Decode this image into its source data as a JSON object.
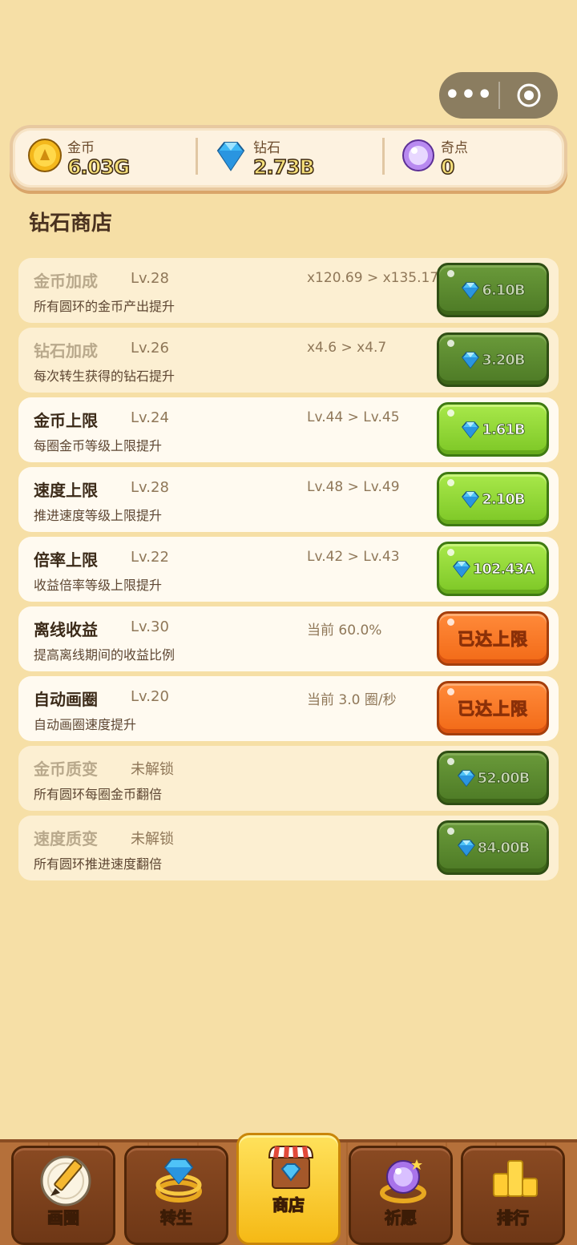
{
  "capsule": {
    "more_label": "•••"
  },
  "currency": {
    "gold": {
      "label": "金币",
      "value": "6.03G"
    },
    "diamond": {
      "label": "钻石",
      "value": "2.73B"
    },
    "wonder": {
      "label": "奇点",
      "value": "0"
    }
  },
  "shop": {
    "title": "钻石商店",
    "items": [
      {
        "name": "金币加成",
        "level": "Lv.28",
        "upgrade": "x120.69 > x135.17",
        "desc": "所有圆环的金币产出提升",
        "button": "6.10B",
        "state": "dim-dark"
      },
      {
        "name": "钻石加成",
        "level": "Lv.26",
        "upgrade": "x4.6 > x4.7",
        "desc": "每次转生获得的钻石提升",
        "button": "3.20B",
        "state": "dim-dark"
      },
      {
        "name": "金币上限",
        "level": "Lv.24",
        "upgrade": "Lv.44 > Lv.45",
        "desc": "每圈金币等级上限提升",
        "button": "1.61B",
        "state": "buy"
      },
      {
        "name": "速度上限",
        "level": "Lv.28",
        "upgrade": "Lv.48 > Lv.49",
        "desc": "推进速度等级上限提升",
        "button": "2.10B",
        "state": "buy"
      },
      {
        "name": "倍率上限",
        "level": "Lv.22",
        "upgrade": "Lv.42 > Lv.43",
        "desc": "收益倍率等级上限提升",
        "button": "102.43A",
        "state": "buy"
      },
      {
        "name": "离线收益",
        "level": "Lv.30",
        "upgrade": "当前 60.0%",
        "desc": "提高离线期间的收益比例",
        "button": "已达上限",
        "state": "max"
      },
      {
        "name": "自动画圈",
        "level": "Lv.20",
        "upgrade": "当前 3.0 圈/秒",
        "desc": "自动画圈速度提升",
        "button": "已达上限",
        "state": "max"
      },
      {
        "name": "金币质变",
        "level": "未解锁",
        "upgrade": "",
        "desc": "所有圆环每圈金币翻倍",
        "button": "52.00B",
        "state": "dim-dark"
      },
      {
        "name": "速度质变",
        "level": "未解锁",
        "upgrade": "",
        "desc": "所有圆环推进速度翻倍",
        "button": "84.00B",
        "state": "dim-dark"
      }
    ]
  },
  "nav": {
    "tabs": [
      {
        "label": "画圈",
        "icon": "pencil-icon"
      },
      {
        "label": "转生",
        "icon": "diamond-ring-icon"
      },
      {
        "label": "商店",
        "icon": "shop-icon",
        "active": true
      },
      {
        "label": "祈愿",
        "icon": "orb-icon"
      },
      {
        "label": "排行",
        "icon": "podium-icon"
      }
    ]
  }
}
